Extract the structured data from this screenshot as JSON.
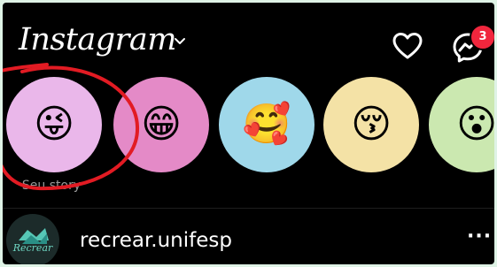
{
  "header": {
    "app_name": "Instagram",
    "chevron_icon": "chevron-down-icon",
    "heart_icon": "heart-icon",
    "messenger_icon": "messenger-icon",
    "messenger_badge": "3"
  },
  "stories": [
    {
      "emoji": "😜",
      "color": "#eab7ea",
      "label": "Seu story"
    },
    {
      "emoji": "😁",
      "color": "#e48ac7",
      "label": ""
    },
    {
      "emoji": "🥰",
      "color": "#9fd8ea",
      "label": ""
    },
    {
      "emoji": "😚",
      "color": "#f4e2a6",
      "label": ""
    },
    {
      "emoji": "😮",
      "color": "#cbe8b0",
      "label": ""
    }
  ],
  "post": {
    "username": "recrear.unifesp",
    "avatar_text": "Recrear",
    "more_label": "···"
  },
  "colors": {
    "badge": "#f0263d",
    "annotation_circle": "#e21b23"
  }
}
